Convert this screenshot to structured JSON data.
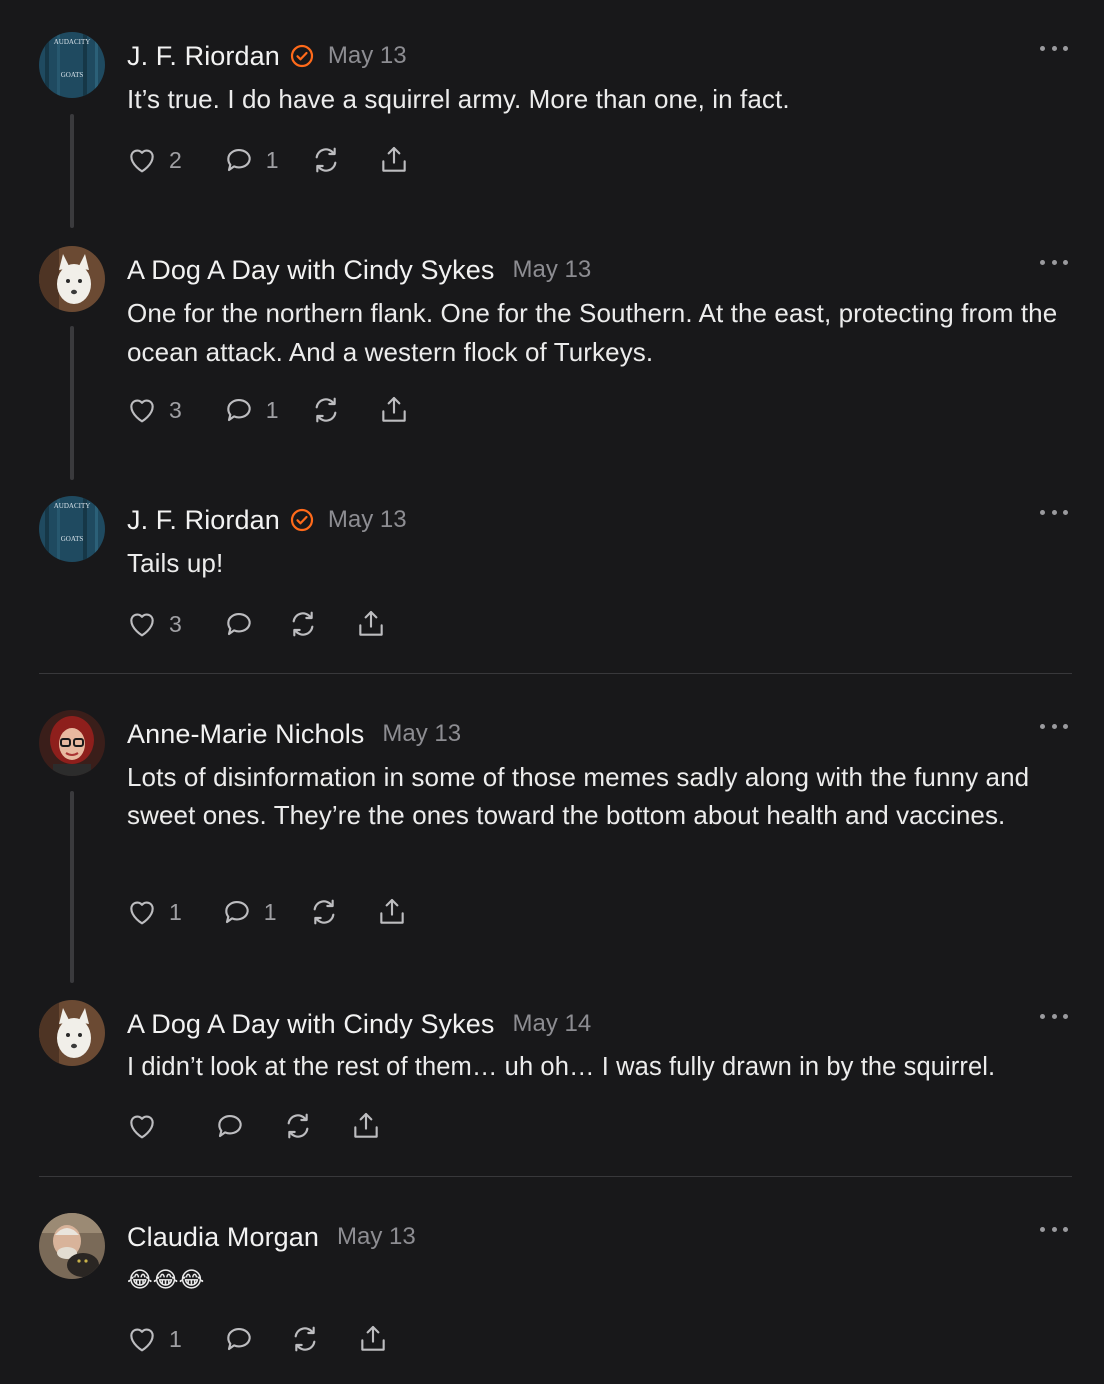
{
  "colors": {
    "background": "#18181a",
    "text": "#ececec",
    "muted": "#8d8d92",
    "verified_badge": "#ff6a1a",
    "thread_line": "#3a3a3d"
  },
  "comments": [
    {
      "author": "J. F. Riordan",
      "verified": true,
      "date": "May 13",
      "text": "It’s true. I do have a squirrel army. More than one, in fact.",
      "likes": "2",
      "replies": "1",
      "avatar_icon": "book-cover-audacity-goats",
      "avatar_text": [
        "AUDACITY",
        "GOATS"
      ]
    },
    {
      "author": "A Dog A Day with Cindy Sykes",
      "verified": false,
      "date": "May 13",
      "text": "One for the northern flank. One for the Southern. At the east, protecting from the ocean attack. And a western flock of Turkeys.",
      "likes": "3",
      "replies": "1",
      "avatar_icon": "white-dog-photo"
    },
    {
      "author": "J. F. Riordan",
      "verified": true,
      "date": "May 13",
      "text": "Tails up!",
      "likes": "3",
      "replies": "",
      "avatar_icon": "book-cover-audacity-goats",
      "avatar_text": [
        "AUDACITY",
        "GOATS"
      ]
    },
    {
      "author": "Anne-Marie Nichols",
      "verified": false,
      "date": "May 13",
      "text": "Lots of disinformation in some of those memes sadly along with the funny and sweet ones. They’re the ones toward the bottom about health and vaccines.",
      "likes": "1",
      "replies": "1",
      "avatar_icon": "woman-red-hair-glasses-photo"
    },
    {
      "author": "A Dog A Day with Cindy Sykes",
      "verified": false,
      "date": "May 14",
      "text": "I didn’t look at the rest of them… uh oh… I was fully drawn in by the squirrel.",
      "likes": "",
      "replies": "",
      "avatar_icon": "white-dog-photo"
    },
    {
      "author": "Claudia Morgan",
      "verified": false,
      "date": "May 13",
      "text": "😂😂😂",
      "likes": "1",
      "replies": "",
      "avatar_icon": "man-with-cat-photo"
    }
  ]
}
